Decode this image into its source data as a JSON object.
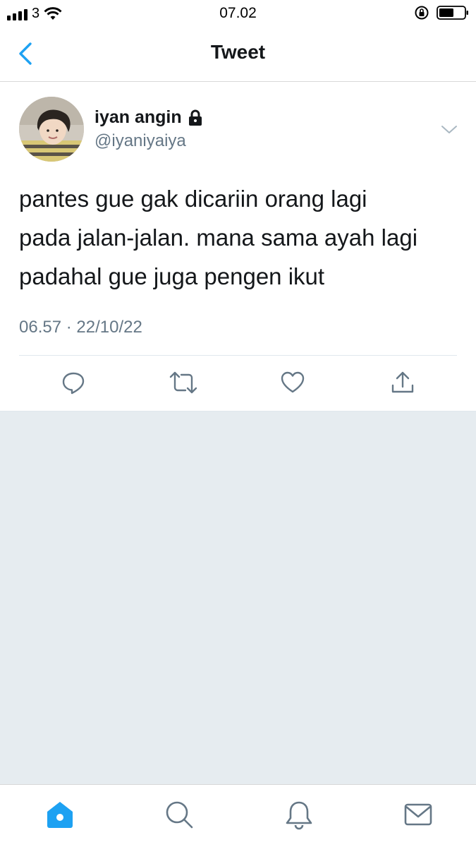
{
  "status_bar": {
    "carrier": "3",
    "time": "07.02"
  },
  "nav": {
    "title": "Tweet",
    "back_icon": "chevron-left-icon"
  },
  "tweet": {
    "display_name": "iyan angin",
    "protected_icon": "lock-icon",
    "handle": "@iyaniyaiya",
    "text_lines": [
      "pantes gue gak dicariin orang lagi",
      "pada jalan-jalan. mana sama ayah lagi",
      "padahal gue juga pengen ikut"
    ],
    "timestamp": "06.57 · 22/10/22",
    "actions": [
      "reply-icon",
      "retweet-icon",
      "like-icon",
      "share-icon"
    ]
  },
  "tab_bar": {
    "tabs": [
      "home-icon",
      "search-icon",
      "notifications-icon",
      "messages-icon"
    ],
    "active": "home-icon"
  },
  "colors": {
    "accent": "#1da1f2",
    "icon_gray": "#657786",
    "background_gray": "#e6ecf0"
  }
}
